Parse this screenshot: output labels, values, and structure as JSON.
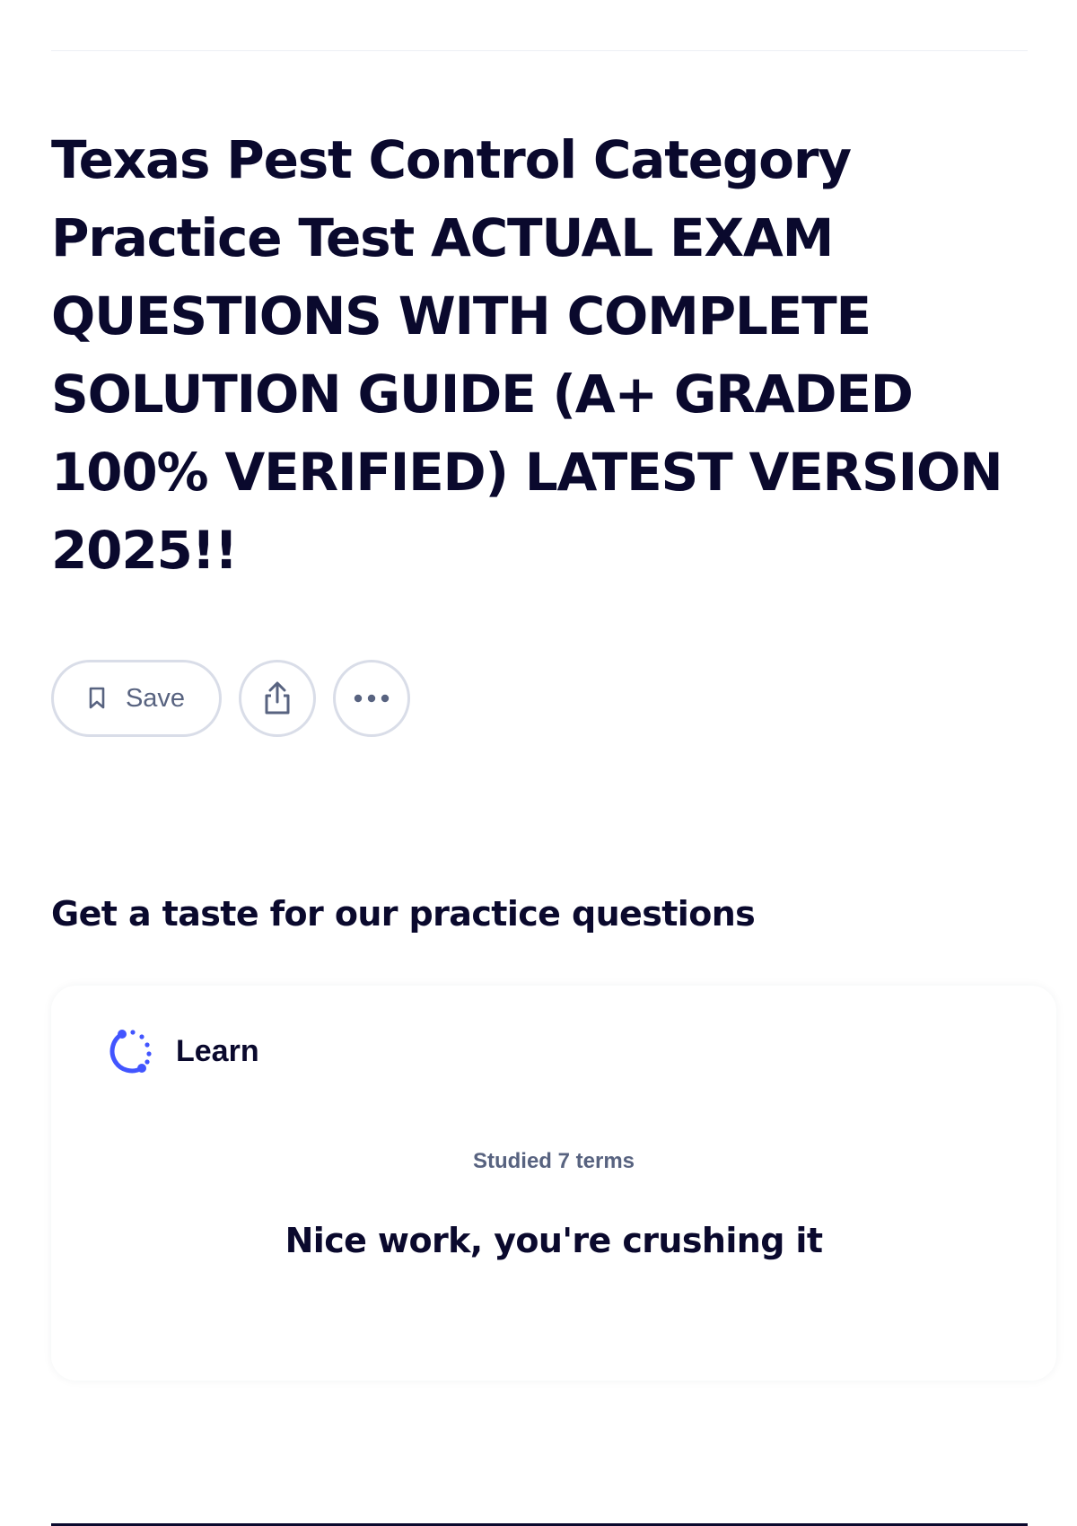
{
  "page": {
    "title": "Texas Pest Control Category Practice Test ACTUAL EXAM QUESTIONS WITH COMPLETE SOLUTION GUIDE (A+ GRADED 100% VERIFIED) LATEST VERSION 2025!!"
  },
  "actions": {
    "save_label": "Save",
    "save_icon": "bookmark-icon",
    "share_icon": "share-icon",
    "more_icon": "more-options-icon"
  },
  "practice": {
    "heading": "Get a taste for our practice questions",
    "card": {
      "mode_label": "Learn",
      "mode_icon": "learn-progress-icon",
      "studied_text": "Studied 7 terms",
      "message": "Nice work, you're crushing it"
    }
  },
  "colors": {
    "text_primary": "#0a092d",
    "text_secondary": "#586380",
    "border": "#d9dde8",
    "accent": "#4255ff"
  }
}
